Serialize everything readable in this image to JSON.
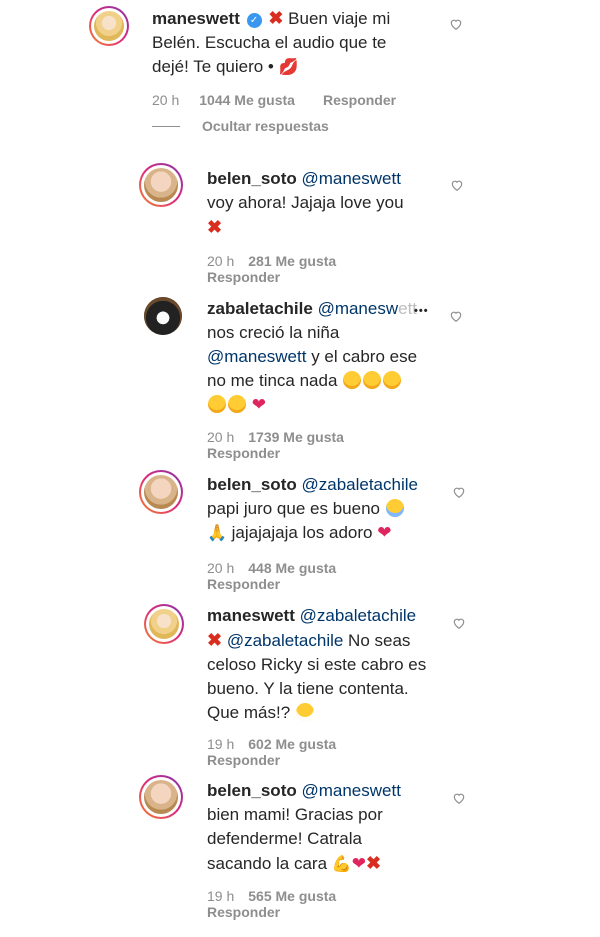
{
  "comments": [
    {
      "user": "maneswett",
      "text_line1": "Buen viaje mi",
      "text_line2": "Belén. Escucha el audio que te",
      "text_line3": "dejé! Te quiero •",
      "time": "20 h",
      "likes": "1044 Me gusta",
      "reply": "Responder",
      "hide_replies": "Ocultar respuestas"
    },
    {
      "user": "belen_soto",
      "mention": "@maneswett",
      "text_line1": "voy ahora! Jajaja love you",
      "time": "20 h",
      "likes": "281 Me gusta",
      "reply": "Responder"
    },
    {
      "user": "zabaletachile",
      "mention": "@manesw",
      "mention_fade": "ett",
      "ellipsis": "•••",
      "text_line1": "nos creció la niña",
      "text_line2_mention": "@maneswett",
      "text_line2": " y el cabro ese",
      "text_line3": "no me tinca nada",
      "time": "20 h",
      "likes": "1739 Me gusta",
      "reply": "Responder"
    },
    {
      "user": "belen_soto",
      "mention": "@zabaletachile",
      "text_line1": "papi juro que es bueno",
      "text_line2": "jajajajaja los adoro",
      "time": "20 h",
      "likes": "448 Me gusta",
      "reply": "Responder"
    },
    {
      "user": "maneswett",
      "mention": "@zabaletachile",
      "text_line1_mention": "@zabaletachile",
      "text_line1": " No seas",
      "text_line2": "celoso Ricky si este cabro es",
      "text_line3": "bueno. Y la tiene contenta.",
      "text_line4": "Que más!?",
      "time": "19 h",
      "likes": "602 Me gusta",
      "reply": "Responder"
    },
    {
      "user": "belen_soto",
      "mention": "@maneswett",
      "text_line1": "bien mami! Gracias por",
      "text_line2": "defenderme! Catrala",
      "text_line3": "sacando la cara",
      "time": "19 h",
      "likes": "565 Me gusta",
      "reply": "Responder"
    }
  ],
  "icons": {
    "verified": "verified-badge-icon",
    "heart": "heart-outline-icon",
    "x": "red-x-emoji",
    "kiss": "lips-emoji",
    "rofl": "rolling-laughing-emoji",
    "red_heart": "red-heart-emoji",
    "crying": "loudly-crying-emoji",
    "pray": "folded-hands-emoji",
    "grimace": "grimacing-emoji",
    "flex": "flexed-biceps-emoji"
  },
  "colors": {
    "mention": "#003569",
    "meta": "#8e8e8e",
    "verified": "#3897f0",
    "red": "#e0245e"
  }
}
